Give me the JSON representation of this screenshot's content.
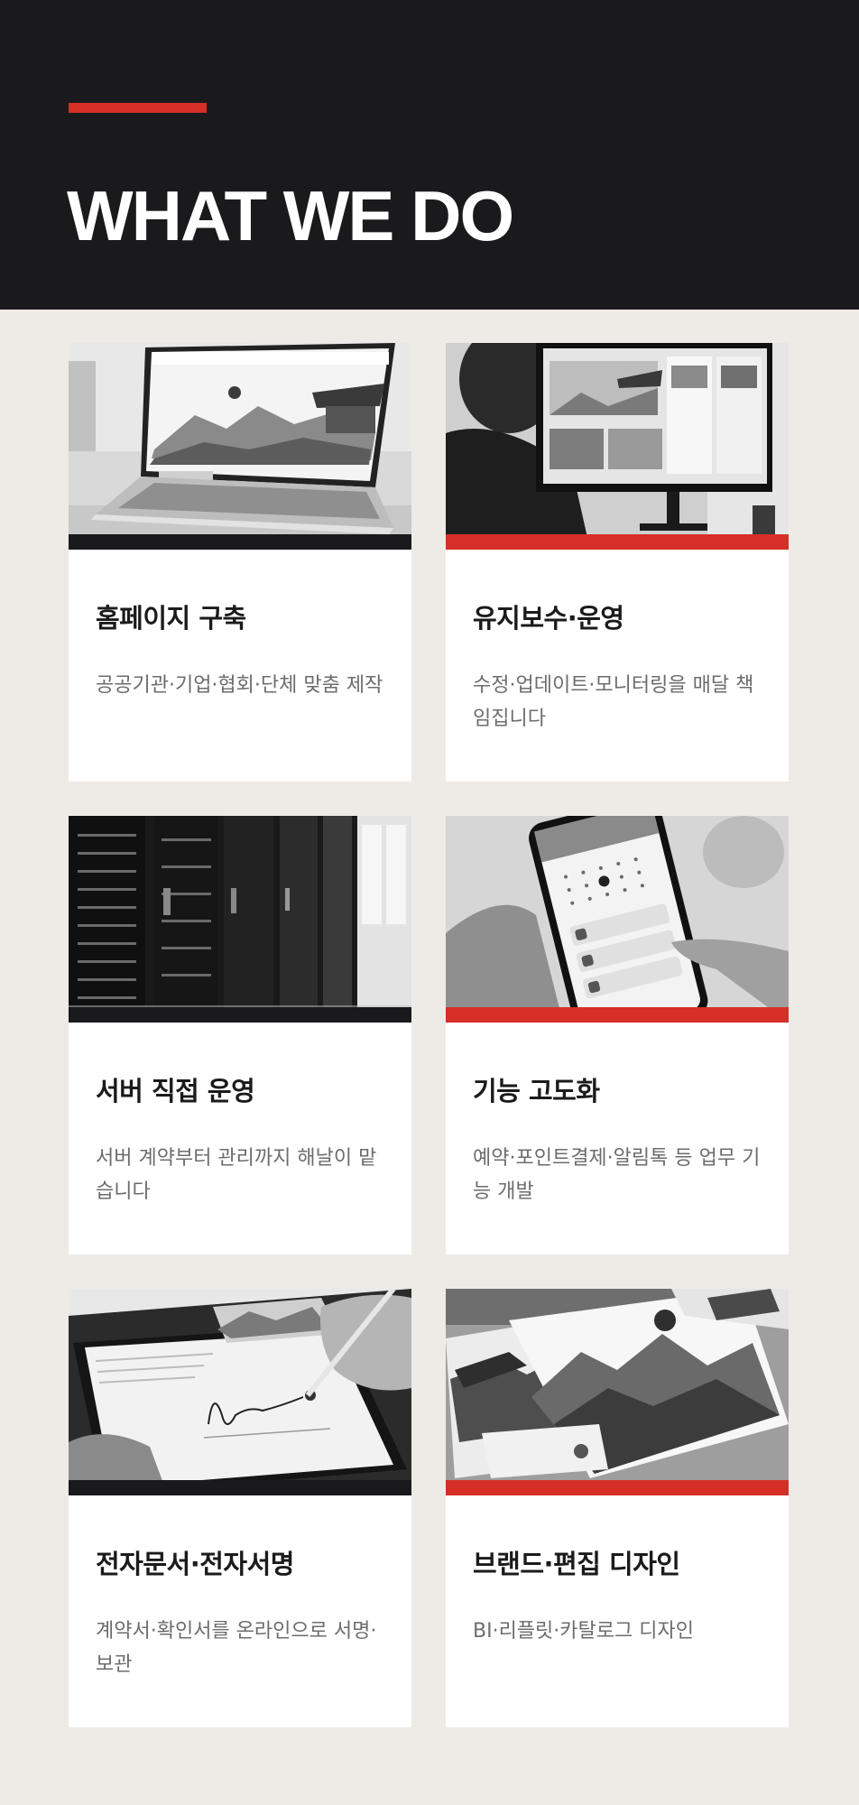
{
  "hero": {
    "title": "WHAT WE DO"
  },
  "colors": {
    "dark": "#1a1a1c",
    "accent": "#d62f27",
    "background": "#eeebe7",
    "card": "#ffffff"
  },
  "services": [
    {
      "title": "홈페이지 구축",
      "desc": "공공기관·기업·협회·단체 맞춤 제작",
      "bar": "dark",
      "image": "laptop-website-photo"
    },
    {
      "title": "유지보수·운영",
      "desc": "수정·업데이트·모니터링을 매달 책임집니다",
      "bar": "red",
      "image": "monitor-workstation-photo"
    },
    {
      "title": "서버 직접 운영",
      "desc": "서버 계약부터 관리까지 해날이 맡습니다",
      "bar": "dark",
      "image": "server-racks-photo"
    },
    {
      "title": "기능 고도화",
      "desc": "예약·포인트결제·알림톡 등 업무 기능 개발",
      "bar": "red",
      "image": "smartphone-app-photo"
    },
    {
      "title": "전자문서·전자서명",
      "desc": "계약서·확인서를 온라인으로 서명·보관",
      "bar": "dark",
      "image": "tablet-signature-photo"
    },
    {
      "title": "브랜드·편집 디자인",
      "desc": "BI·리플릿·카탈로그 디자인",
      "bar": "red",
      "image": "print-brochures-photo"
    }
  ]
}
